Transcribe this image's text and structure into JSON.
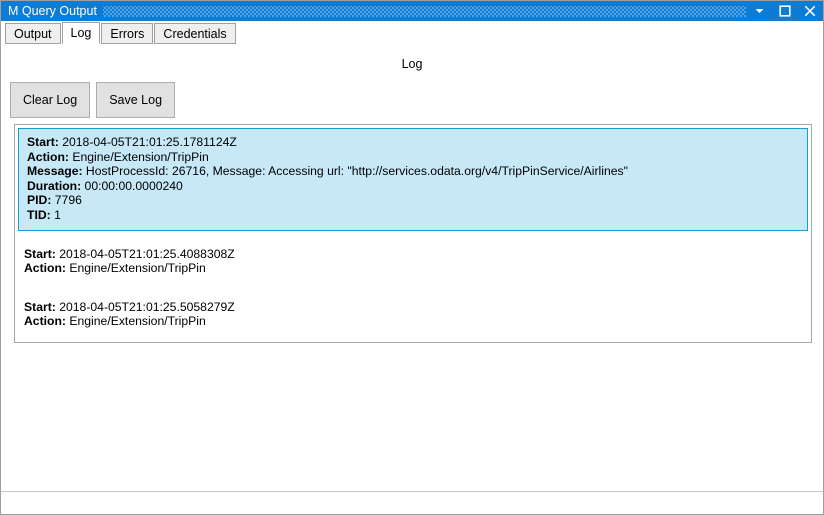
{
  "window": {
    "title": "M Query Output",
    "buttons": [
      {
        "name": "dropdown-button",
        "icon": "chevron-down-icon",
        "label": ""
      },
      {
        "name": "maximize-button",
        "icon": "maximize-icon",
        "label": ""
      },
      {
        "name": "close-button",
        "icon": "close-icon",
        "label": ""
      }
    ],
    "colors": {
      "titlebar": "#0c7cd5",
      "selection_fill": "#c6e8f7",
      "selection_border": "#1a9ad6",
      "button_face": "#e1e1e1",
      "panel_border": "#a6a6a6"
    }
  },
  "tabs": [
    {
      "label": "Output",
      "selected": false
    },
    {
      "label": "Log",
      "selected": true
    },
    {
      "label": "Errors",
      "selected": false
    },
    {
      "label": "Credentials",
      "selected": false
    }
  ],
  "page": {
    "heading": "Log"
  },
  "toolbar": {
    "clear_label": "Clear Log",
    "save_label": "Save Log"
  },
  "log": {
    "entries": [
      {
        "selected": true,
        "fields": [
          {
            "key": "Start:",
            "value": "2018-04-05T21:01:25.1781124Z"
          },
          {
            "key": "Action:",
            "value": "Engine/Extension/TripPin"
          },
          {
            "key": "Message:",
            "value": "HostProcessId: 26716, Message: Accessing url: \"http://services.odata.org/v4/TripPinService/Airlines\""
          },
          {
            "key": "Duration:",
            "value": "00:00:00.0000240"
          },
          {
            "key": "PID:",
            "value": "7796"
          },
          {
            "key": "TID:",
            "value": "1"
          }
        ]
      },
      {
        "selected": false,
        "fields": [
          {
            "key": "Start:",
            "value": "2018-04-05T21:01:25.4088308Z"
          },
          {
            "key": "Action:",
            "value": "Engine/Extension/TripPin"
          }
        ]
      },
      {
        "selected": false,
        "fields": [
          {
            "key": "Start:",
            "value": "2018-04-05T21:01:25.5058279Z"
          },
          {
            "key": "Action:",
            "value": "Engine/Extension/TripPin"
          }
        ]
      }
    ]
  }
}
